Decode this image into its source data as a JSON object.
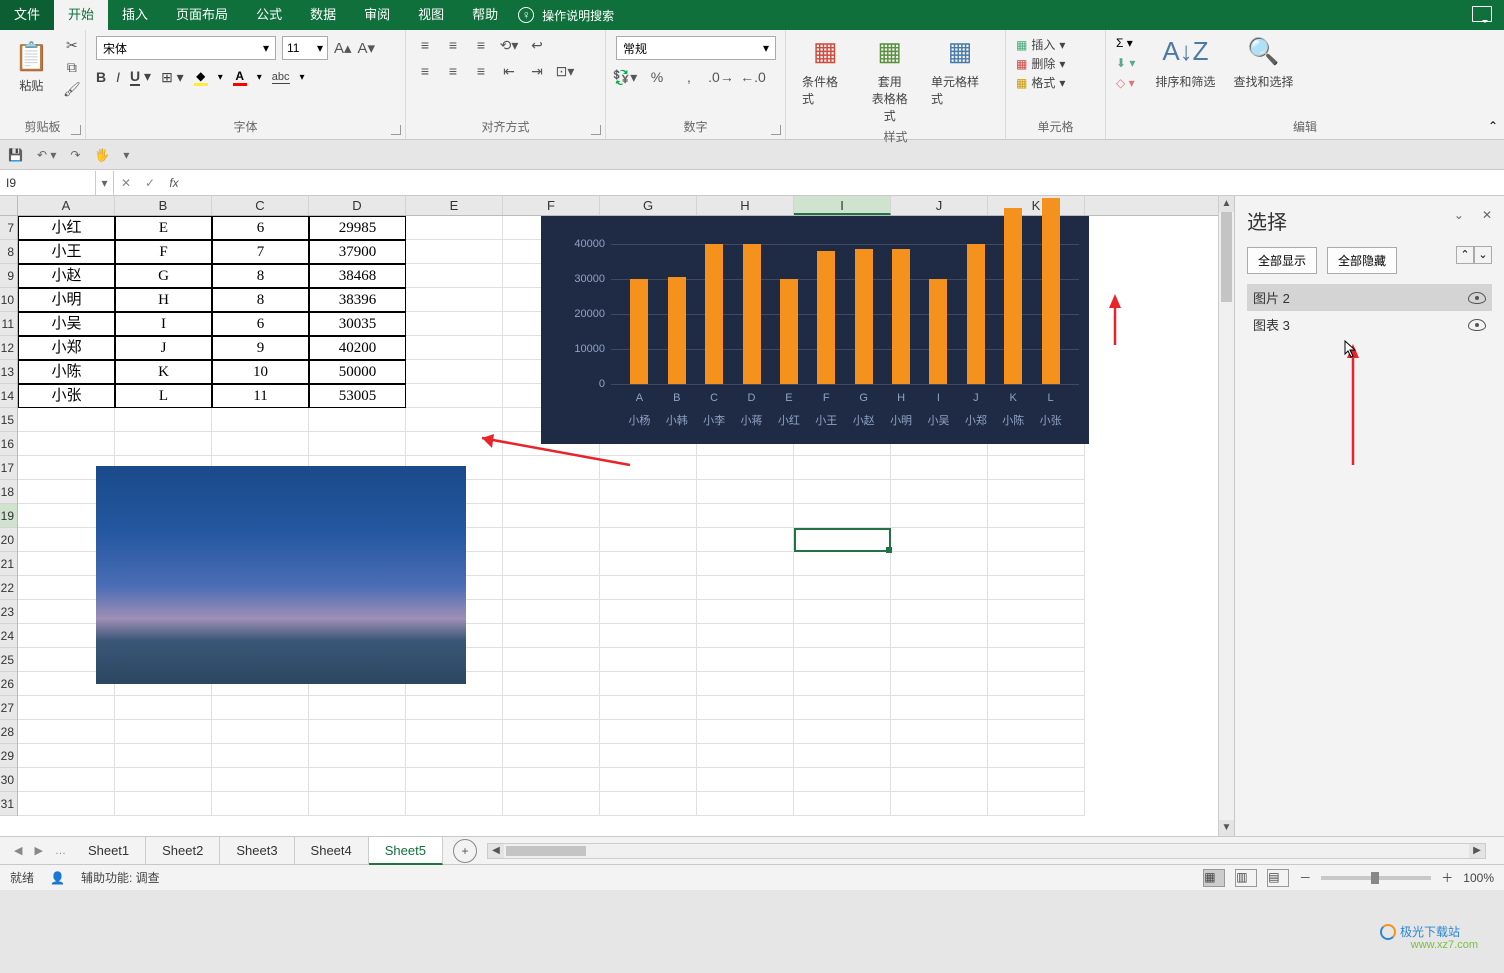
{
  "tabs": {
    "file": "文件",
    "home": "开始",
    "insert": "插入",
    "layout": "页面布局",
    "formula": "公式",
    "data": "数据",
    "review": "审阅",
    "view": "视图",
    "help": "帮助",
    "tell": "操作说明搜索"
  },
  "ribbon": {
    "clipboard": {
      "paste": "粘贴",
      "label": "剪贴板"
    },
    "font": {
      "name": "宋体",
      "size": "11",
      "label": "字体",
      "abc": "abc"
    },
    "align": {
      "label": "对齐方式"
    },
    "number": {
      "format": "常规",
      "label": "数字"
    },
    "styles": {
      "cond": "条件格式",
      "table": "套用\n表格格式",
      "cell": "单元格样式",
      "label": "样式"
    },
    "cells": {
      "insert": "插入",
      "delete": "删除",
      "format": "格式",
      "label": "单元格"
    },
    "editing": {
      "sort": "排序和筛选",
      "find": "查找和选择",
      "label": "编辑"
    },
    "sigma": "Σ"
  },
  "namebox": "I9",
  "columns": [
    "A",
    "B",
    "C",
    "D",
    "E",
    "F",
    "G",
    "H",
    "I",
    "J",
    "K"
  ],
  "row_start": 7,
  "table": [
    {
      "name": "小红",
      "col2": "E",
      "col3": "6",
      "col4": "29985"
    },
    {
      "name": "小王",
      "col2": "F",
      "col3": "7",
      "col4": "37900"
    },
    {
      "name": "小赵",
      "col2": "G",
      "col3": "8",
      "col4": "38468"
    },
    {
      "name": "小明",
      "col2": "H",
      "col3": "8",
      "col4": "38396"
    },
    {
      "name": "小吴",
      "col2": "I",
      "col3": "6",
      "col4": "30035"
    },
    {
      "name": "小郑",
      "col2": "J",
      "col3": "9",
      "col4": "40200"
    },
    {
      "name": "小陈",
      "col2": "K",
      "col3": "10",
      "col4": "50000"
    },
    {
      "name": "小张",
      "col2": "L",
      "col3": "11",
      "col4": "53005"
    }
  ],
  "row_numbers": [
    "7",
    "8",
    "9",
    "10",
    "11",
    "12",
    "13",
    "14",
    "15",
    "16",
    "17",
    "18",
    "19",
    "20",
    "21",
    "22",
    "23",
    "24",
    "25",
    "26",
    "27",
    "28",
    "29",
    "30",
    "31"
  ],
  "chart_data": {
    "type": "bar",
    "categories": [
      "A",
      "B",
      "C",
      "D",
      "E",
      "F",
      "G",
      "H",
      "I",
      "J",
      "K",
      "L"
    ],
    "names": [
      "小杨",
      "小韩",
      "小李",
      "小蒋",
      "小红",
      "小王",
      "小赵",
      "小明",
      "小吴",
      "小郑",
      "小陈",
      "小张"
    ],
    "values": [
      30000,
      30500,
      40000,
      40000,
      30000,
      38000,
      38500,
      38500,
      30000,
      40000,
      50000,
      53000
    ],
    "yticks": [
      0,
      10000,
      20000,
      30000,
      40000
    ],
    "ymax": 45000,
    "bar_color": "#f5921e",
    "bg": "#1f2a44"
  },
  "selpane": {
    "title": "选择",
    "showall": "全部显示",
    "hideall": "全部隐藏",
    "items": [
      {
        "label": "图片 2"
      },
      {
        "label": "图表 3"
      }
    ]
  },
  "sheets": [
    "Sheet1",
    "Sheet2",
    "Sheet3",
    "Sheet4",
    "Sheet5"
  ],
  "active_sheet": 4,
  "status": {
    "ready": "就绪",
    "acc": "辅助功能: 调查",
    "zoom": "100%"
  },
  "watermark": {
    "brand": "极光下载站",
    "url": "www.xz7.com"
  }
}
